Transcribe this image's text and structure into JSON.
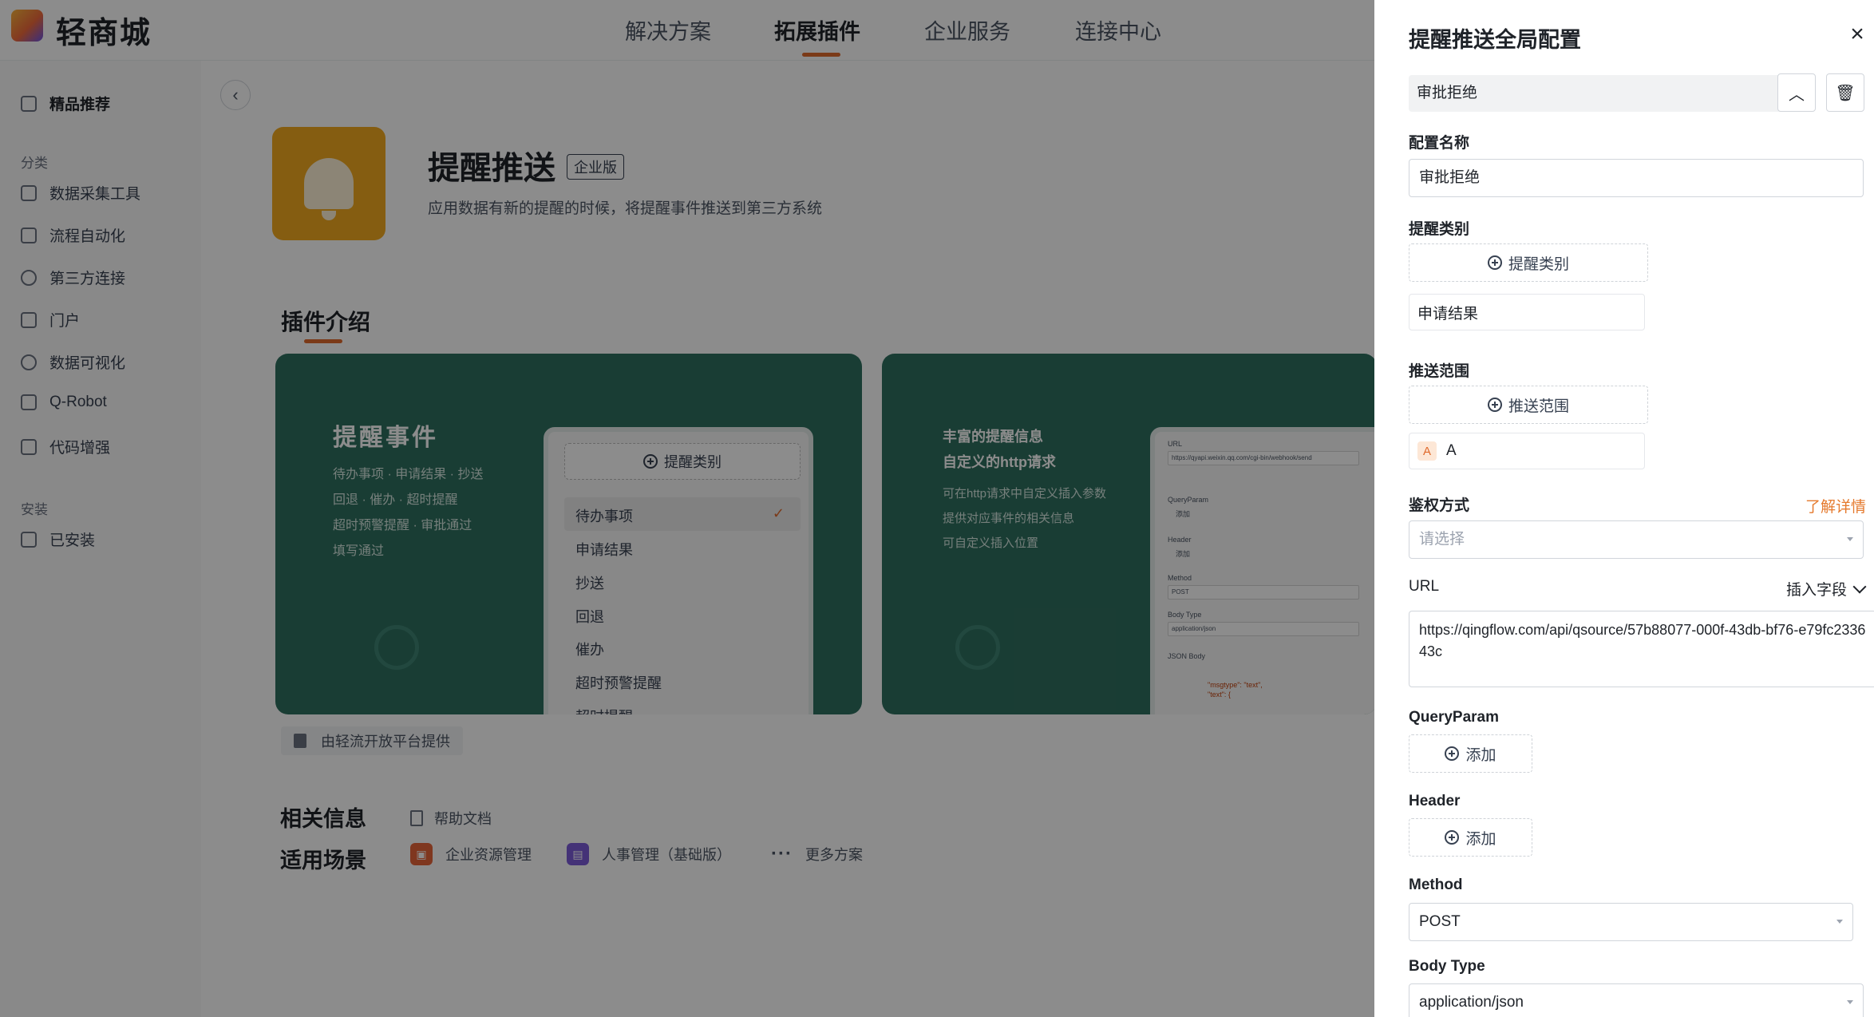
{
  "app": {
    "name": "轻商城"
  },
  "topnav": [
    {
      "label": "解决方案"
    },
    {
      "label": "拓展插件"
    },
    {
      "label": "企业服务"
    },
    {
      "label": "连接中心"
    }
  ],
  "sidebar": {
    "featured": "精品推荐",
    "group_category": "分类",
    "items": [
      {
        "label": "数据采集工具"
      },
      {
        "label": "流程自动化"
      },
      {
        "label": "第三方连接"
      },
      {
        "label": "门户"
      },
      {
        "label": "数据可视化"
      },
      {
        "label": "Q-Robot"
      },
      {
        "label": "代码增强"
      }
    ],
    "group_install": "安装",
    "installed": "已安装"
  },
  "plugin": {
    "name": "提醒推送",
    "edition": "企业版",
    "description": "应用数据有新的提醒的时候，将提醒事件推送到第三方系统"
  },
  "intro": {
    "title": "插件介绍",
    "card1": {
      "heading": "提醒事件",
      "lines": [
        "待办事项 · 申请结果 · 抄送",
        "回退 · 催办 · 超时提醒",
        "超时预警提醒 · 审批通过",
        "填写通过"
      ],
      "mock_button": "提醒类别",
      "mock_items": [
        "待办事项",
        "申请结果",
        "抄送",
        "回退",
        "催办",
        "超时预警提醒",
        "超时提醒"
      ]
    },
    "card2": {
      "heading1": "丰富的提醒信息",
      "heading2": "自定义的http请求",
      "lines": [
        "可在http请求中自定义插入参数",
        "提供对应事件的相关信息",
        "可自定义插入位置"
      ],
      "mock": {
        "url_label": "URL",
        "url_value": "https://qyapi.weixin.qq.com/cgi-bin/webhook/send",
        "queryparam_label": "QueryParam",
        "add": "添加",
        "header_label": "Header",
        "method_label": "Method",
        "method_value": "POST",
        "bodytype_label": "Body Type",
        "bodytype_value": "application/json",
        "json_label": "JSON Body",
        "json_line1": "\"msgtype\": \"text\",",
        "json_line2": "\"text\": {"
      }
    },
    "provider": "由轻流开放平台提供"
  },
  "related": {
    "label": "相关信息",
    "help_doc": "帮助文档"
  },
  "scenarios": {
    "label": "适用场景",
    "items": [
      {
        "label": "企业资源管理",
        "color": "#e8643a"
      },
      {
        "label": "人事管理（基础版）",
        "color": "#7c5bd9"
      }
    ],
    "more": "更多方案"
  },
  "drawer": {
    "title": "提醒推送全局配置",
    "config_tab": "审批拒绝",
    "config_name_label": "配置名称",
    "config_name_value": "审批拒绝",
    "remind_type_label": "提醒类别",
    "remind_type_button": "提醒类别",
    "remind_type_value": "申请结果",
    "scope_label": "推送范围",
    "scope_button": "推送范围",
    "scope_avatar": "A",
    "scope_value": "A",
    "auth_label": "鉴权方式",
    "learn_more": "了解详情",
    "auth_placeholder": "请选择",
    "url_label": "URL",
    "insert_field": "插入字段",
    "url_value": "https://qingflow.com/api/qsource/57b88077-000f-43db-bf76-e79fc233643c",
    "queryparam_label": "QueryParam",
    "add_label": "添加",
    "header_label": "Header",
    "method_label": "Method",
    "method_value": "POST",
    "bodytype_label": "Body Type",
    "bodytype_value": "application/json"
  },
  "colors": {
    "accent": "#e06a2c",
    "card_bg": "#2f6f5f",
    "plugin_icon": "#f2a91f"
  }
}
